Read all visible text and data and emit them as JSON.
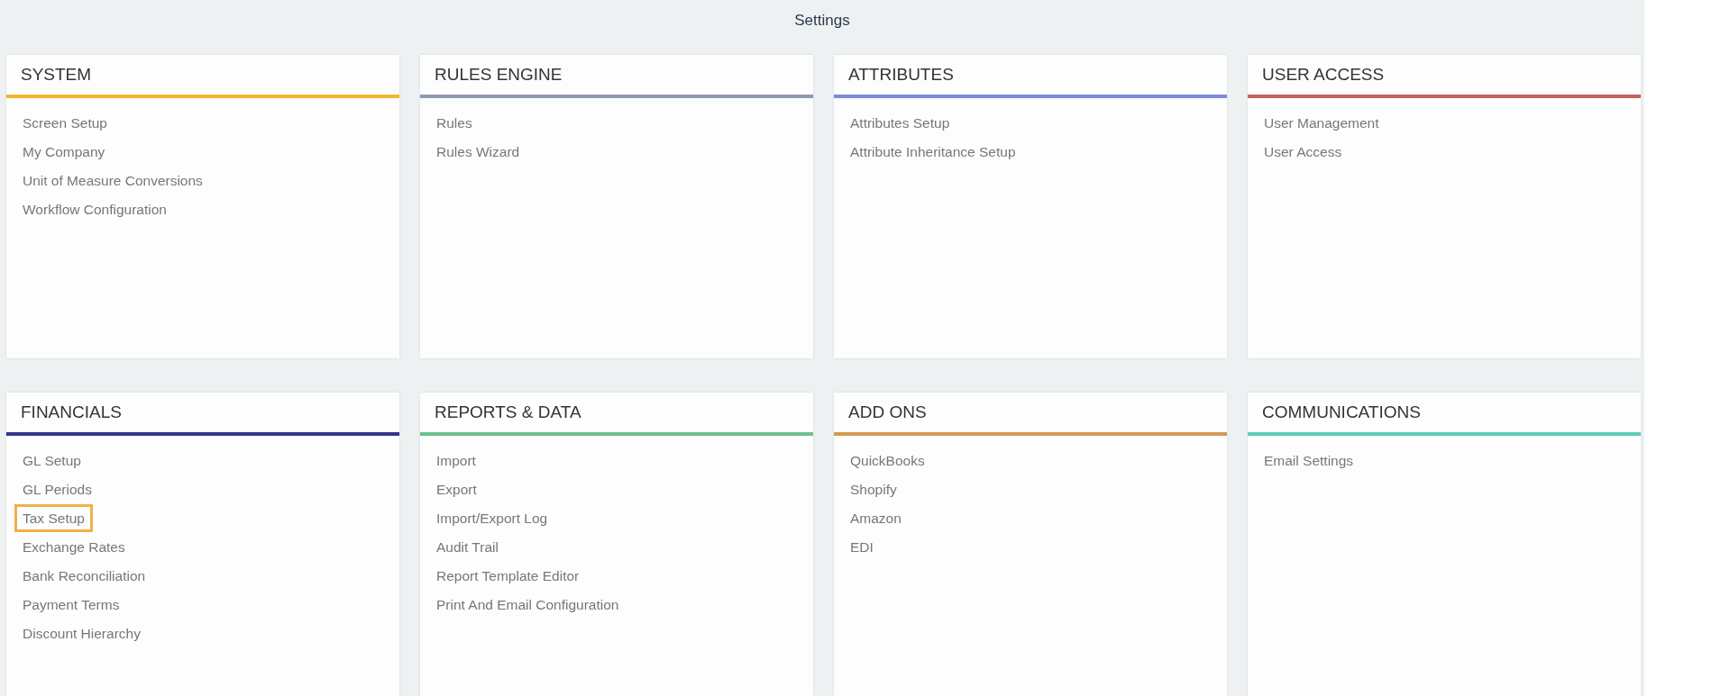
{
  "page_title": "Settings",
  "sections": [
    {
      "title": "SYSTEM",
      "color": "#f2b632",
      "items": [
        {
          "label": "Screen Setup",
          "selected": false
        },
        {
          "label": "My Company",
          "selected": false
        },
        {
          "label": "Unit of Measure Conversions",
          "selected": false
        },
        {
          "label": "Workflow Configuration",
          "selected": false
        }
      ]
    },
    {
      "title": "RULES ENGINE",
      "color": "#8e9aaf",
      "items": [
        {
          "label": "Rules",
          "selected": false
        },
        {
          "label": "Rules Wizard",
          "selected": false
        }
      ]
    },
    {
      "title": "ATTRIBUTES",
      "color": "#8088e0",
      "items": [
        {
          "label": "Attributes Setup",
          "selected": false
        },
        {
          "label": "Attribute Inheritance Setup",
          "selected": false
        }
      ]
    },
    {
      "title": "USER ACCESS",
      "color": "#c9615f",
      "items": [
        {
          "label": "User Management",
          "selected": false
        },
        {
          "label": "User Access",
          "selected": false
        }
      ]
    },
    {
      "title": "FINANCIALS",
      "color": "#35348a",
      "items": [
        {
          "label": "GL Setup",
          "selected": false
        },
        {
          "label": "GL Periods",
          "selected": false
        },
        {
          "label": "Tax Setup",
          "selected": true
        },
        {
          "label": "Exchange Rates",
          "selected": false
        },
        {
          "label": "Bank Reconciliation",
          "selected": false
        },
        {
          "label": "Payment Terms",
          "selected": false
        },
        {
          "label": "Discount Hierarchy",
          "selected": false
        }
      ]
    },
    {
      "title": "REPORTS & DATA",
      "color": "#6cc18e",
      "items": [
        {
          "label": "Import",
          "selected": false
        },
        {
          "label": "Export",
          "selected": false
        },
        {
          "label": "Import/Export Log",
          "selected": false
        },
        {
          "label": "Audit Trail",
          "selected": false
        },
        {
          "label": "Report Template Editor",
          "selected": false
        },
        {
          "label": "Print And Email Configuration",
          "selected": false
        }
      ]
    },
    {
      "title": "ADD ONS",
      "color": "#d39a52",
      "items": [
        {
          "label": "QuickBooks",
          "selected": false
        },
        {
          "label": "Shopify",
          "selected": false
        },
        {
          "label": "Amazon",
          "selected": false
        },
        {
          "label": "EDI",
          "selected": false
        }
      ]
    },
    {
      "title": "COMMUNICATIONS",
      "color": "#5ccdb8",
      "items": [
        {
          "label": "Email Settings",
          "selected": false
        }
      ]
    }
  ]
}
